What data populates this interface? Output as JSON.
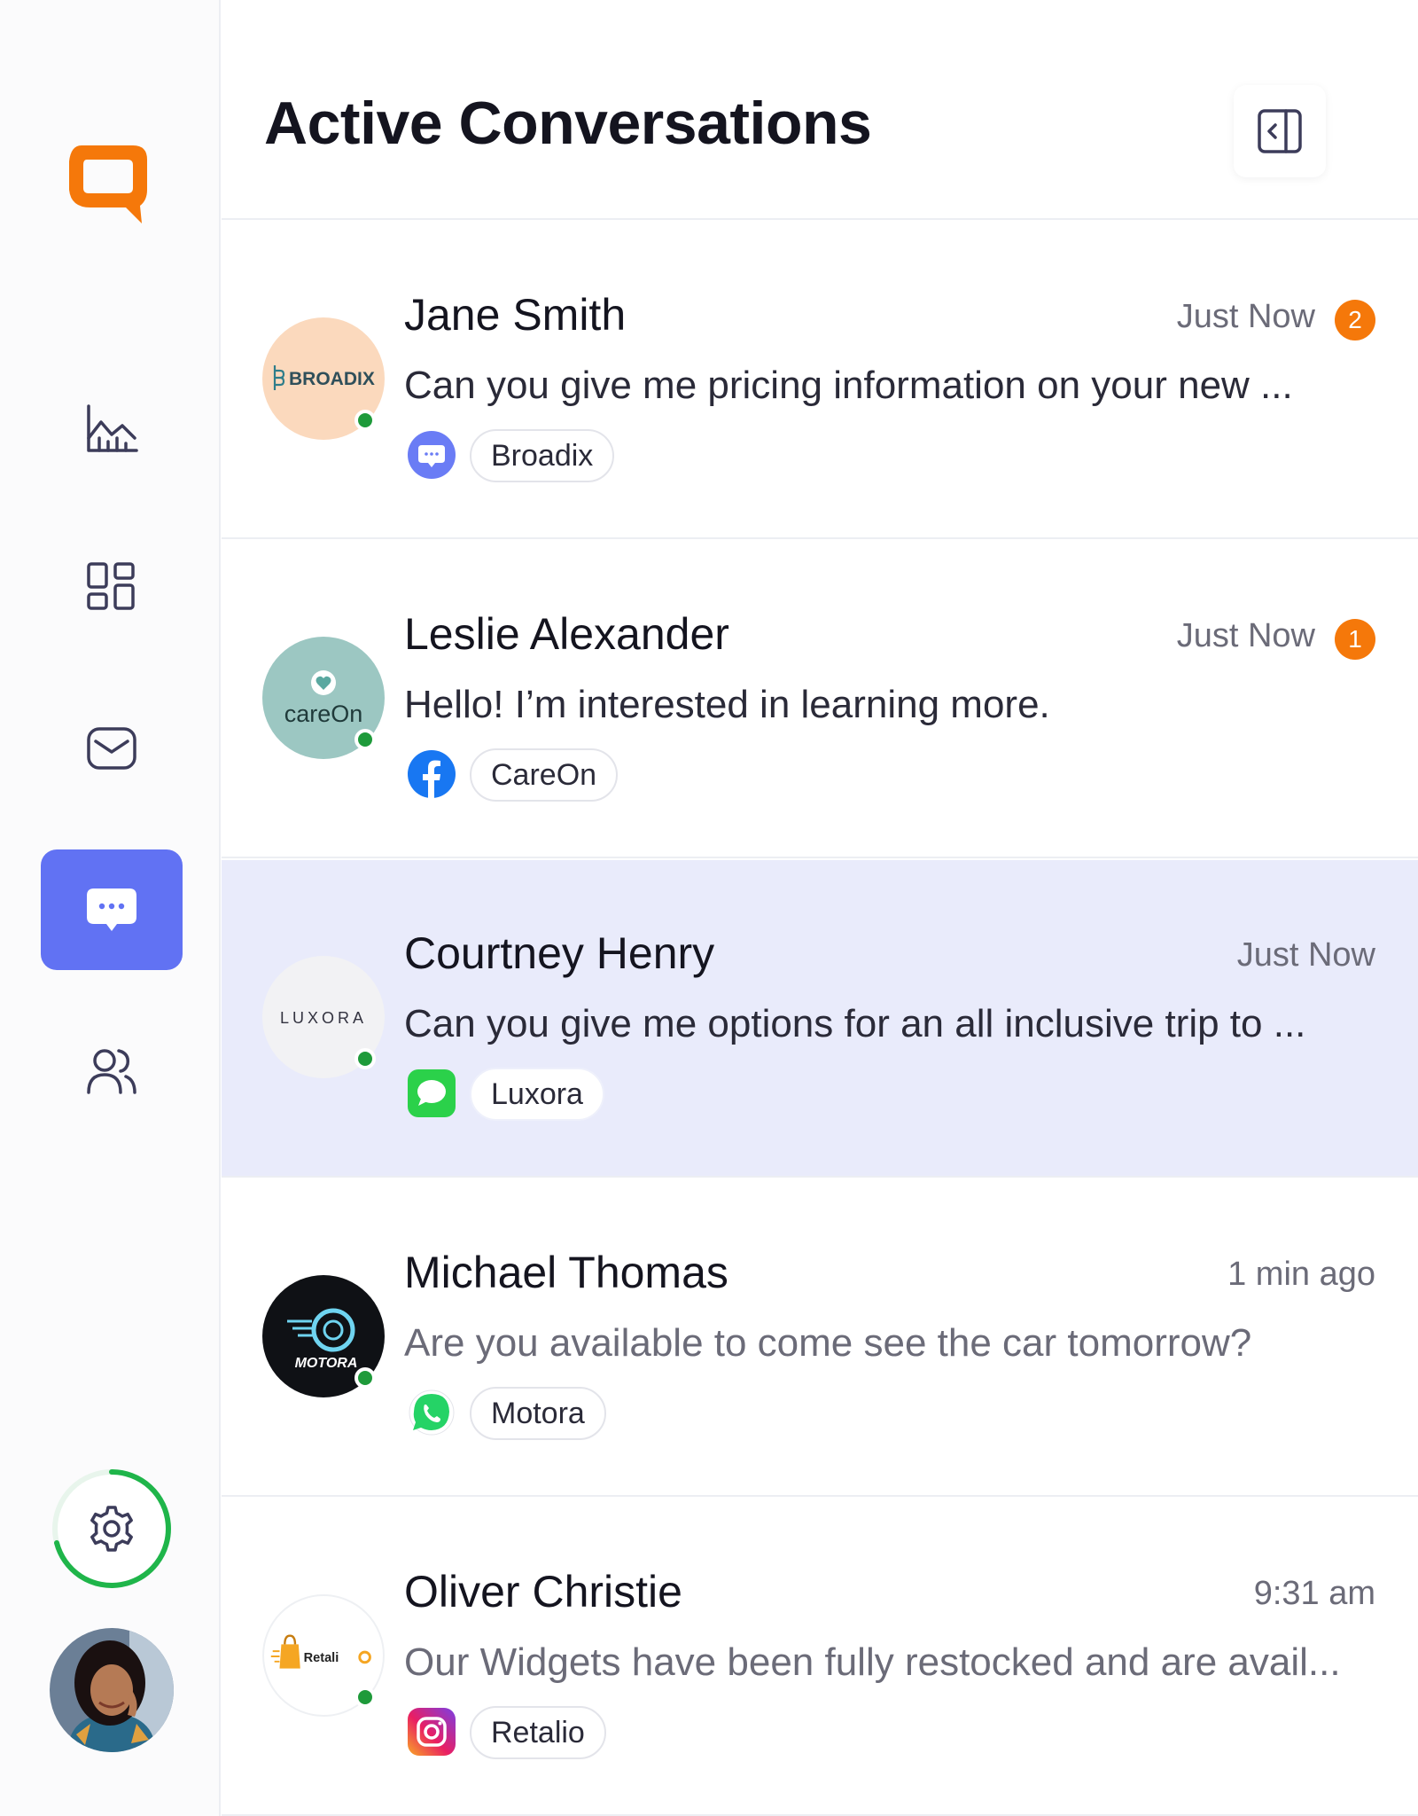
{
  "header": {
    "title": "Active Conversations"
  },
  "sidebar": {
    "items": [
      {
        "icon": "analytics-chart-icon"
      },
      {
        "icon": "dashboard-grid-icon"
      },
      {
        "icon": "inbox-icon"
      },
      {
        "icon": "chat-bubble-icon",
        "active": true
      },
      {
        "icon": "contacts-icon"
      }
    ],
    "settings_icon": "gear-icon"
  },
  "colors": {
    "accent": "#6172f3",
    "badge": "#f5780a",
    "online": "#1e9a3a",
    "brand": "#f5780a"
  },
  "conversations": [
    {
      "name": "Jane Smith",
      "time": "Just Now",
      "unread": "2",
      "message": "Can you give me pricing information on your new ...",
      "channel": "messenger-icon",
      "company": "Broadix",
      "logo_text": "BROADIX"
    },
    {
      "name": "Leslie Alexander",
      "time": "Just Now",
      "unread": "1",
      "message": "Hello! I’m interested in learning more.",
      "channel": "facebook-icon",
      "company": "CareOn",
      "logo_text": "careOn"
    },
    {
      "name": "Courtney Henry",
      "time": "Just Now",
      "message": "Can you give me options for an all inclusive trip to ...",
      "channel": "imessage-icon",
      "company": "Luxora",
      "logo_text": "LUXORA"
    },
    {
      "name": "Michael Thomas",
      "time": "1 min ago",
      "message": "Are you available to come see the car tomorrow?",
      "channel": "whatsapp-icon",
      "company": "Motora",
      "logo_text": "MOTORA"
    },
    {
      "name": "Oliver Christie",
      "time": "9:31 am",
      "message": "Our Widgets have been fully restocked and are avail...",
      "channel": "instagram-icon",
      "company": "Retalio",
      "logo_text": "Retali"
    }
  ]
}
